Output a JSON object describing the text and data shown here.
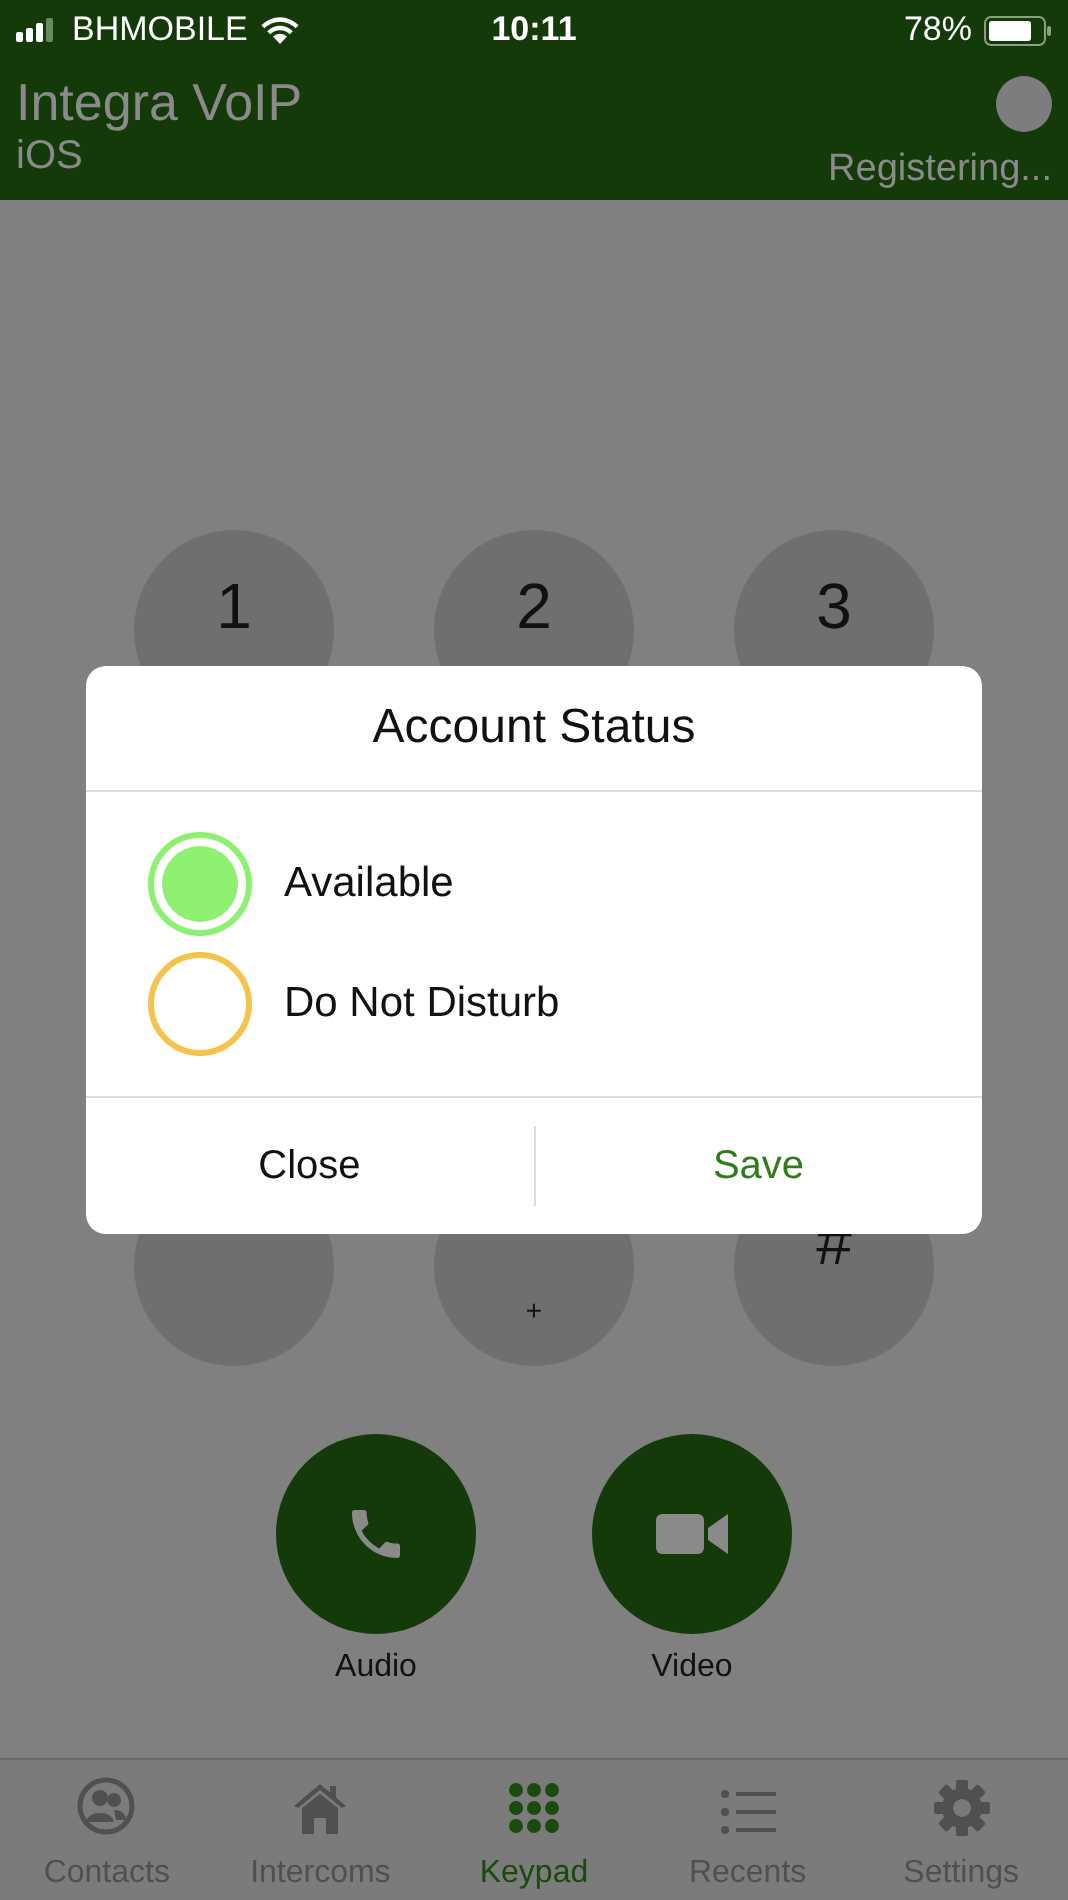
{
  "status_bar": {
    "carrier": "BHMOBILE",
    "time": "10:11",
    "battery": "78%"
  },
  "header": {
    "title": "Integra VoIP",
    "subtitle": "iOS",
    "status": "Registering..."
  },
  "keypad": {
    "top_row": [
      {
        "digit": "1"
      },
      {
        "digit": "2"
      },
      {
        "digit": "3"
      }
    ],
    "bottom_row": [
      {
        "kind": "key"
      },
      {
        "kind": "key",
        "letters": "+"
      },
      {
        "kind": "key",
        "digit": "#"
      }
    ]
  },
  "call_buttons": [
    {
      "kind": "audio",
      "label": "Audio"
    },
    {
      "kind": "video",
      "label": "Video"
    }
  ],
  "dialog": {
    "title": "Account Status",
    "options": [
      {
        "label": "Available",
        "selected": true
      },
      {
        "label": "Do Not Disturb",
        "selected": false
      }
    ],
    "buttons": [
      {
        "label": "Close",
        "kind": "cancel"
      },
      {
        "label": "Save",
        "kind": "confirm"
      }
    ]
  },
  "tabs": [
    {
      "label": "Contacts",
      "selected": false
    },
    {
      "label": "Intercoms",
      "selected": false
    },
    {
      "label": "Keypad",
      "selected": true
    },
    {
      "label": "Recents",
      "selected": false
    },
    {
      "label": "Settings",
      "selected": false
    }
  ]
}
